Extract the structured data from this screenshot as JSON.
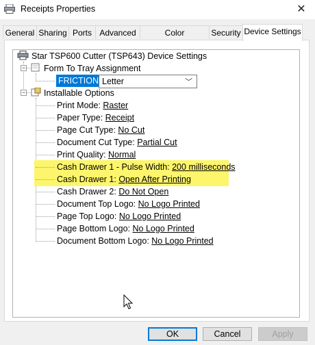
{
  "window": {
    "title": "Receipts Properties",
    "close_glyph": "✕"
  },
  "tabs": [
    {
      "label": "General"
    },
    {
      "label": "Sharing"
    },
    {
      "label": "Ports"
    },
    {
      "label": "Advanced"
    },
    {
      "label": "Color Management"
    },
    {
      "label": "Security"
    },
    {
      "label": "Device Settings",
      "active": true
    }
  ],
  "tree": {
    "root": "Star TSP600 Cutter (TSP643) Device Settings",
    "tray_group": "Form To Tray Assignment",
    "friction_label": "FRICTION:",
    "friction_value": "Letter",
    "options_group": "Installable Options",
    "options": [
      {
        "name": "Print Mode: ",
        "value": "Raster"
      },
      {
        "name": "Paper Type: ",
        "value": "Receipt"
      },
      {
        "name": "Page Cut Type: ",
        "value": "No Cut"
      },
      {
        "name": "Document Cut Type: ",
        "value": "Partial Cut"
      },
      {
        "name": "Print Quality: ",
        "value": "Normal"
      },
      {
        "name": "Cash Drawer 1 - Pulse Width: ",
        "value": "200 milliseconds",
        "highlight": true
      },
      {
        "name": "Cash Drawer 1: ",
        "value": "Open After Printing",
        "highlight": true
      },
      {
        "name": "Cash Drawer 2: ",
        "value": "Do Not Open"
      },
      {
        "name": "Document Top Logo: ",
        "value": "No Logo Printed"
      },
      {
        "name": "Page Top Logo: ",
        "value": "No Logo Printed"
      },
      {
        "name": "Page Bottom Logo: ",
        "value": "No Logo Printed"
      },
      {
        "name": "Document Bottom Logo: ",
        "value": "No Logo Printed"
      }
    ]
  },
  "buttons": {
    "ok": "OK",
    "cancel": "Cancel",
    "apply": "Apply"
  },
  "colors": {
    "highlight": "#fdf56b",
    "selection": "#0078d7"
  }
}
